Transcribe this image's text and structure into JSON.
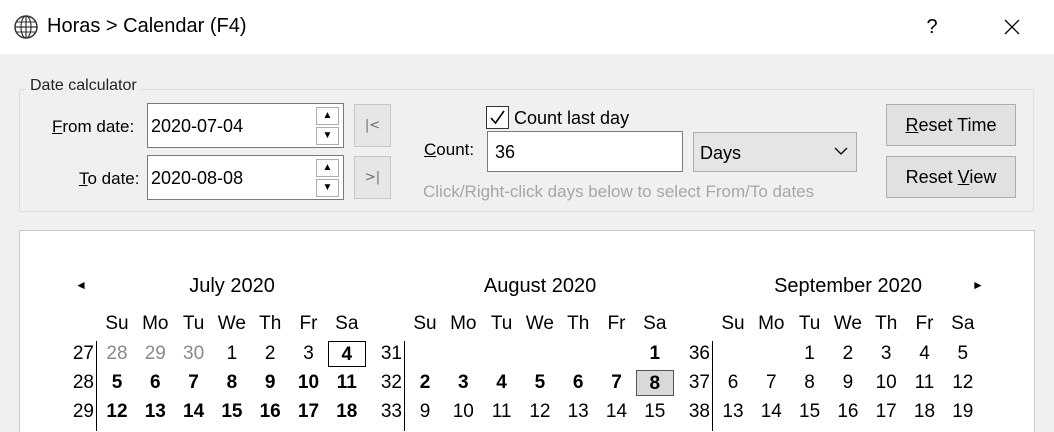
{
  "window": {
    "title": "Horas > Calendar (F4)",
    "help": "?",
    "close": "✕"
  },
  "calc": {
    "group_title": "Date calculator",
    "from_label_u": "F",
    "from_label_rest": "rom date:",
    "from_value": "2020-07-04",
    "to_label_u": "T",
    "to_label_rest": "o date:",
    "to_value": "2020-08-08",
    "count_last_day_label": "Count last day",
    "count_last_day_checked": true,
    "count_label_u": "C",
    "count_label_rest": "ount:",
    "count_value": "36",
    "unit_value": "Days",
    "hint": "Click/Right-click days below to select From/To dates",
    "reset_time_u": "R",
    "reset_time_rest": "eset Time",
    "reset_view_pre": "Reset ",
    "reset_view_u": "V",
    "reset_view_rest": "iew",
    "first_btn": "|<",
    "last_btn": ">|"
  },
  "calendar": {
    "prev": "◄",
    "next": "►",
    "dow": [
      "Su",
      "Mo",
      "Tu",
      "We",
      "Th",
      "Fr",
      "Sa"
    ],
    "months": [
      {
        "title": "July 2020",
        "weeks": [
          {
            "wk": "27",
            "days": [
              {
                "d": "28",
                "s": "gray"
              },
              {
                "d": "29",
                "s": "gray"
              },
              {
                "d": "30",
                "s": "gray"
              },
              {
                "d": "1"
              },
              {
                "d": "2"
              },
              {
                "d": "3"
              },
              {
                "d": "4",
                "s": "bold outlined"
              }
            ]
          },
          {
            "wk": "28",
            "days": [
              {
                "d": "5",
                "s": "bold"
              },
              {
                "d": "6",
                "s": "bold"
              },
              {
                "d": "7",
                "s": "bold"
              },
              {
                "d": "8",
                "s": "bold"
              },
              {
                "d": "9",
                "s": "bold"
              },
              {
                "d": "10",
                "s": "bold"
              },
              {
                "d": "11",
                "s": "bold"
              }
            ]
          },
          {
            "wk": "29",
            "days": [
              {
                "d": "12",
                "s": "bold"
              },
              {
                "d": "13",
                "s": "bold"
              },
              {
                "d": "14",
                "s": "bold"
              },
              {
                "d": "15",
                "s": "bold"
              },
              {
                "d": "16",
                "s": "bold"
              },
              {
                "d": "17",
                "s": "bold"
              },
              {
                "d": "18",
                "s": "bold"
              }
            ]
          }
        ]
      },
      {
        "title": "August 2020",
        "weeks": [
          {
            "wk": "31",
            "days": [
              {
                "d": ""
              },
              {
                "d": ""
              },
              {
                "d": ""
              },
              {
                "d": ""
              },
              {
                "d": ""
              },
              {
                "d": ""
              },
              {
                "d": "1",
                "s": "bold"
              }
            ]
          },
          {
            "wk": "32",
            "days": [
              {
                "d": "2",
                "s": "bold"
              },
              {
                "d": "3",
                "s": "bold"
              },
              {
                "d": "4",
                "s": "bold"
              },
              {
                "d": "5",
                "s": "bold"
              },
              {
                "d": "6",
                "s": "bold"
              },
              {
                "d": "7",
                "s": "bold"
              },
              {
                "d": "8",
                "s": "bold selected"
              }
            ]
          },
          {
            "wk": "33",
            "days": [
              {
                "d": "9"
              },
              {
                "d": "10"
              },
              {
                "d": "11"
              },
              {
                "d": "12"
              },
              {
                "d": "13"
              },
              {
                "d": "14"
              },
              {
                "d": "15"
              }
            ]
          }
        ]
      },
      {
        "title": "September 2020",
        "weeks": [
          {
            "wk": "36",
            "days": [
              {
                "d": ""
              },
              {
                "d": ""
              },
              {
                "d": "1"
              },
              {
                "d": "2"
              },
              {
                "d": "3"
              },
              {
                "d": "4"
              },
              {
                "d": "5"
              }
            ]
          },
          {
            "wk": "37",
            "days": [
              {
                "d": "6"
              },
              {
                "d": "7"
              },
              {
                "d": "8"
              },
              {
                "d": "9"
              },
              {
                "d": "10"
              },
              {
                "d": "11"
              },
              {
                "d": "12"
              }
            ]
          },
          {
            "wk": "38",
            "days": [
              {
                "d": "13"
              },
              {
                "d": "14"
              },
              {
                "d": "15"
              },
              {
                "d": "16"
              },
              {
                "d": "17"
              },
              {
                "d": "18"
              },
              {
                "d": "19"
              }
            ]
          }
        ]
      }
    ]
  }
}
